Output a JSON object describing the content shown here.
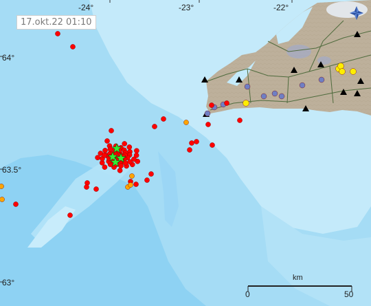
{
  "timestamp": "17.okt.22  01:10",
  "longitude_labels": [
    "-24°",
    "-23°",
    "-22°"
  ],
  "latitude_labels": [
    "64°",
    "63.5°",
    "63°"
  ],
  "scale_bar": {
    "unit": "km",
    "start_label": "0",
    "end_label": "50"
  },
  "colors": {
    "deep_sea": "#8ed2f3",
    "mid_sea": "#a9def6",
    "shallow_sea": "#c4eafa",
    "land": "#bdb09b",
    "glacier": "#e2e6ea",
    "road": "#4f6b3d",
    "quake_recent": "#ff0000",
    "quake_older": "#ffa500",
    "volcano": "#000000",
    "tremor_station": "#6f7fc4",
    "gps_station": "#ffee00",
    "large_quake_star": "#33ee33"
  },
  "legend_icons": [
    "compass-icon"
  ]
}
